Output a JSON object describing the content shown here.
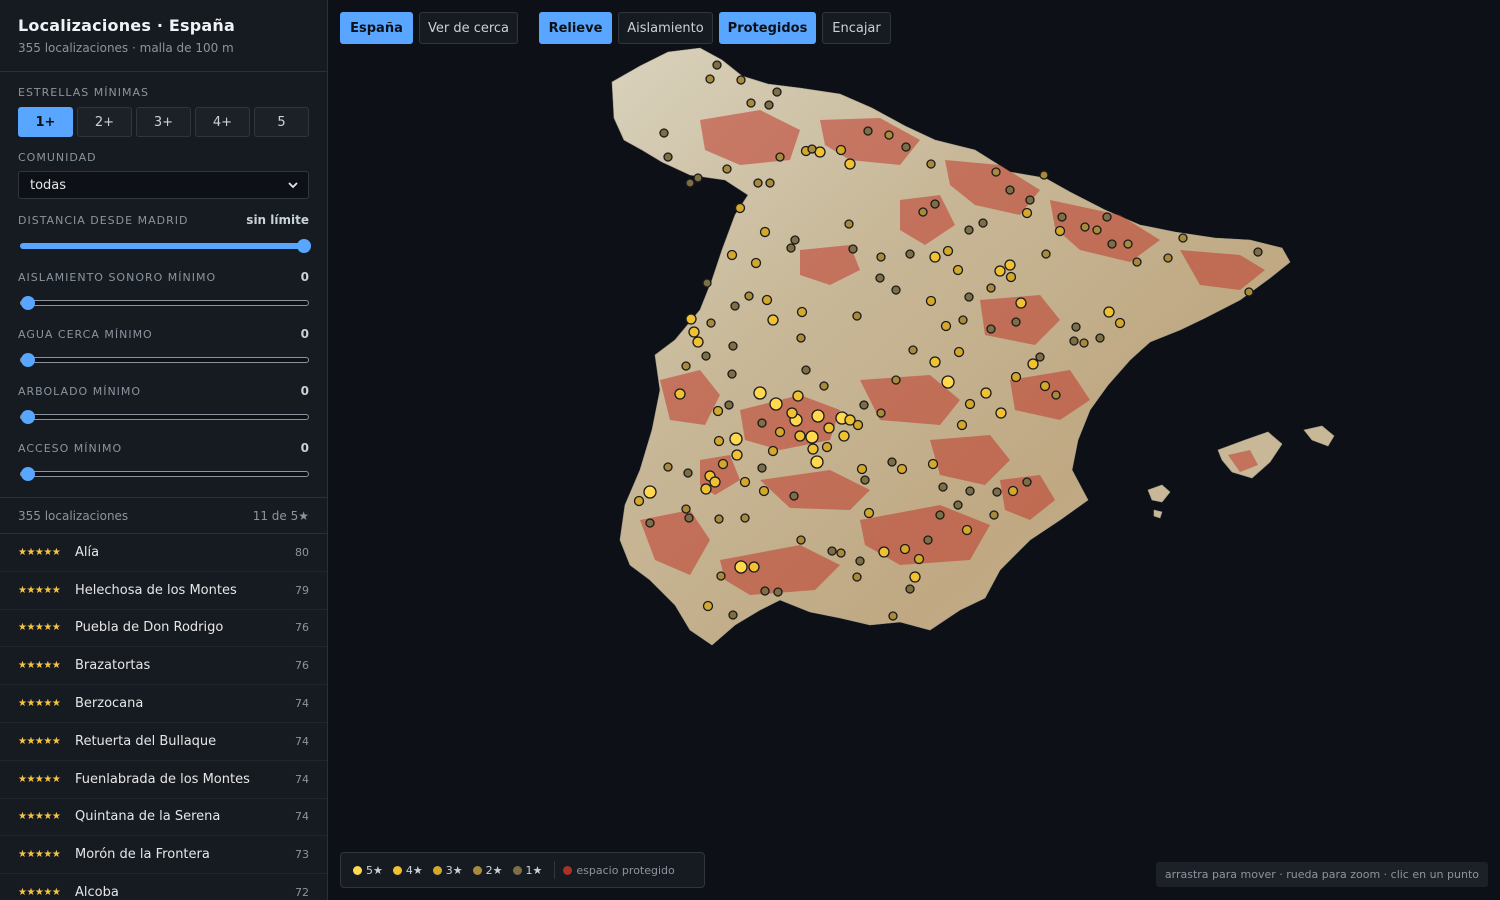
{
  "sidebar": {
    "title": "Localizaciones · España",
    "subtitle": "355 localizaciones · malla de 100 m",
    "stars_label": "ESTRELLAS MÍNIMAS",
    "stars_options": [
      "1+",
      "2+",
      "3+",
      "4+",
      "5"
    ],
    "stars_selected": "1+",
    "community_label": "COMUNIDAD",
    "community_value": "todas",
    "distance_label": "DISTANCIA DESDE MADRID",
    "distance_value": "sin límite",
    "distance_fraction": 1.0,
    "noise_label": "AISLAMIENTO SONORO MÍNIMO",
    "noise_value": "0",
    "water_label": "AGUA CERCA MÍNIMO",
    "water_value": "0",
    "trees_label": "ARBOLADO MÍNIMO",
    "trees_value": "0",
    "access_label": "ACCESO MÍNIMO",
    "access_value": "0",
    "list_count": "355 localizaciones",
    "list_five": "11 de 5★",
    "items": [
      {
        "stars": "★★★★★",
        "name": "Alía",
        "score": "80"
      },
      {
        "stars": "★★★★★",
        "name": "Helechosa de los Montes",
        "score": "79"
      },
      {
        "stars": "★★★★★",
        "name": "Puebla de Don Rodrigo",
        "score": "76"
      },
      {
        "stars": "★★★★★",
        "name": "Brazatortas",
        "score": "76"
      },
      {
        "stars": "★★★★★",
        "name": "Berzocana",
        "score": "74"
      },
      {
        "stars": "★★★★★",
        "name": "Retuerta del Bullaque",
        "score": "74"
      },
      {
        "stars": "★★★★★",
        "name": "Fuenlabrada de los Montes",
        "score": "74"
      },
      {
        "stars": "★★★★★",
        "name": "Quintana de la Serena",
        "score": "74"
      },
      {
        "stars": "★★★★★",
        "name": "Morón de la Frontera",
        "score": "73"
      },
      {
        "stars": "★★★★★",
        "name": "Alcoba",
        "score": "72"
      }
    ]
  },
  "toolbar": {
    "espana": "España",
    "cerca": "Ver de cerca",
    "relieve": "Relieve",
    "aislamiento": "Aislamiento",
    "protegidos": "Protegidos",
    "encajar": "Encajar"
  },
  "legend": {
    "s5": "5★",
    "s4": "4★",
    "s3": "3★",
    "s2": "2★",
    "s1": "1★",
    "protected": "espacio protegido"
  },
  "colors": {
    "accent": "#58a6ff",
    "star5": "#ffd84d",
    "star4": "#f0c232",
    "star3": "#d4a82b",
    "star2": "#a88a3a",
    "star1": "#7d6e45",
    "protected": "#c0392b"
  },
  "hint": "arrastra para mover · rueda para zoom · clic en un punto"
}
